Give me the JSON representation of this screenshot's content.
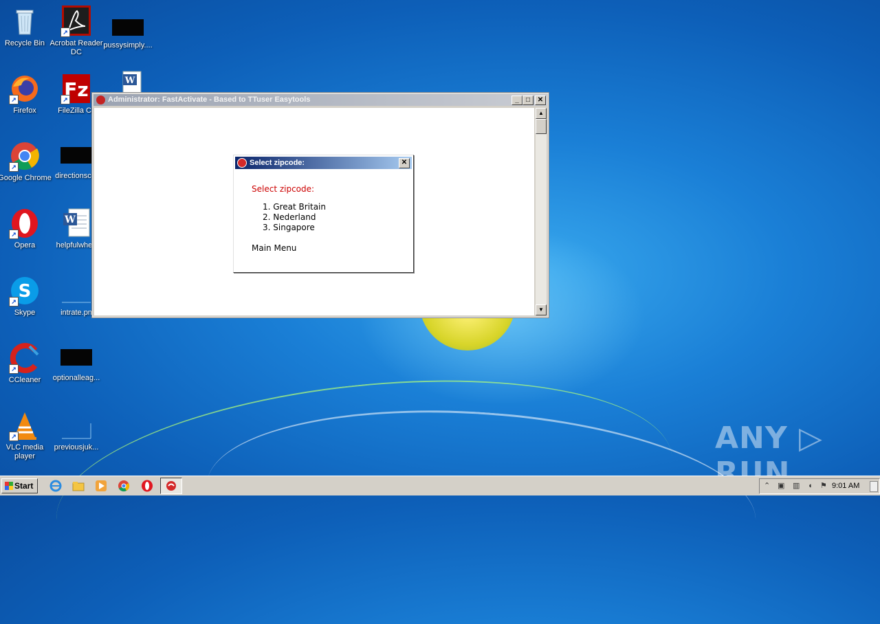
{
  "desktop": {
    "icons": [
      {
        "label": "Recycle Bin"
      },
      {
        "label": "Acrobat Reader DC"
      },
      {
        "label": "pussysimply...."
      },
      {
        "label": "Firefox"
      },
      {
        "label": "FileZilla Cli"
      },
      {
        "label": ""
      },
      {
        "label": "Google Chrome"
      },
      {
        "label": "directionsc..."
      },
      {
        "label": "Opera"
      },
      {
        "label": "helpfulwhen"
      },
      {
        "label": "Skype"
      },
      {
        "label": "intrate.pn"
      },
      {
        "label": "CCleaner"
      },
      {
        "label": "optionalleag..."
      },
      {
        "label": "VLC media player"
      },
      {
        "label": "previousjuk..."
      }
    ]
  },
  "window": {
    "title": "Administrator:  FastActivate - Based to TTuser Easytools",
    "minimize": "_",
    "maximize": "□",
    "close": "✕"
  },
  "dialog": {
    "title": "Select zipcode:",
    "close": "✕",
    "heading": "Select zipcode:",
    "options": [
      "1. Great Britain",
      "2. Nederland",
      "3. Singapore"
    ],
    "main_menu": "Main Menu"
  },
  "taskbar": {
    "start_label": "Start",
    "clock": "9:01 AM"
  },
  "watermark": "ANY ▷ RUN",
  "colors": {
    "desktop_blue": "#1a7fd6",
    "dialog_title": "#0a246a",
    "dialog_heading": "#cc0000",
    "taskbar": "#d4d0c8"
  }
}
